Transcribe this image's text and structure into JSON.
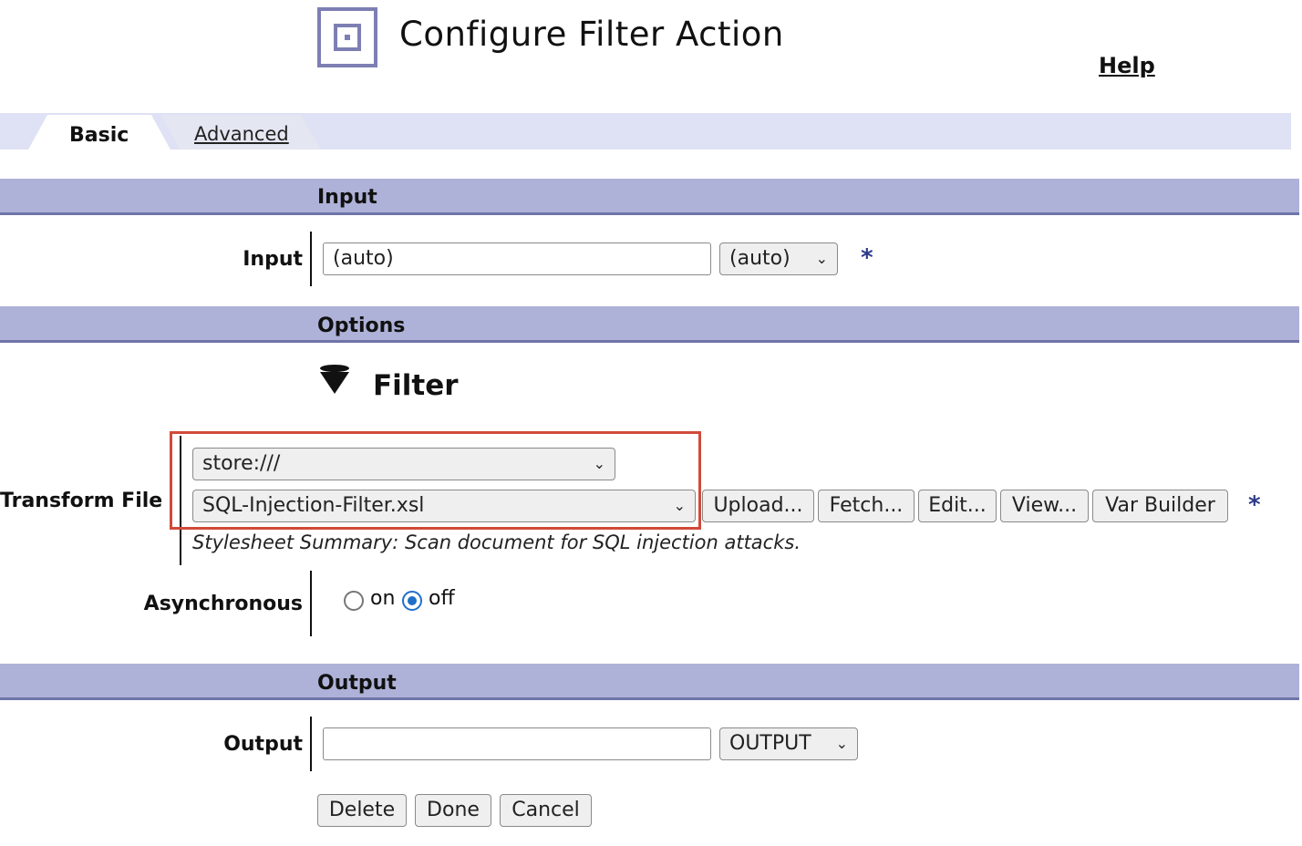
{
  "header": {
    "title": "Configure Filter Action",
    "help_label": "Help"
  },
  "tabs": [
    {
      "label": "Basic",
      "active": true
    },
    {
      "label": "Advanced",
      "active": false
    }
  ],
  "sections": {
    "input": "Input",
    "options": "Options",
    "output": "Output"
  },
  "input_field": {
    "label": "Input",
    "value": "(auto)",
    "context_select": "(auto)",
    "required_marker": "*"
  },
  "filter": {
    "title": "Filter",
    "icon": "funnel-icon"
  },
  "transform_file": {
    "label": "Transform File",
    "location_select": "store:///",
    "file_select": "SQL-Injection-Filter.xsl",
    "buttons": [
      "Upload...",
      "Fetch...",
      "Edit...",
      "View...",
      "Var Builder"
    ],
    "required_marker": "*",
    "summary": "Stylesheet Summary: Scan document for SQL injection attacks."
  },
  "asynchronous": {
    "label": "Asynchronous",
    "options": [
      "on",
      "off"
    ],
    "selected": "off"
  },
  "output_field": {
    "label": "Output",
    "value": "",
    "context_select": "OUTPUT"
  },
  "actions": {
    "delete": "Delete",
    "done": "Done",
    "cancel": "Cancel"
  },
  "colors": {
    "section_bar": "#aeb2d8",
    "tab_bar": "#dfe1f4",
    "highlight": "#d14a3a",
    "required": "#2b3a8a",
    "radio_selected": "#1f6fc8"
  }
}
